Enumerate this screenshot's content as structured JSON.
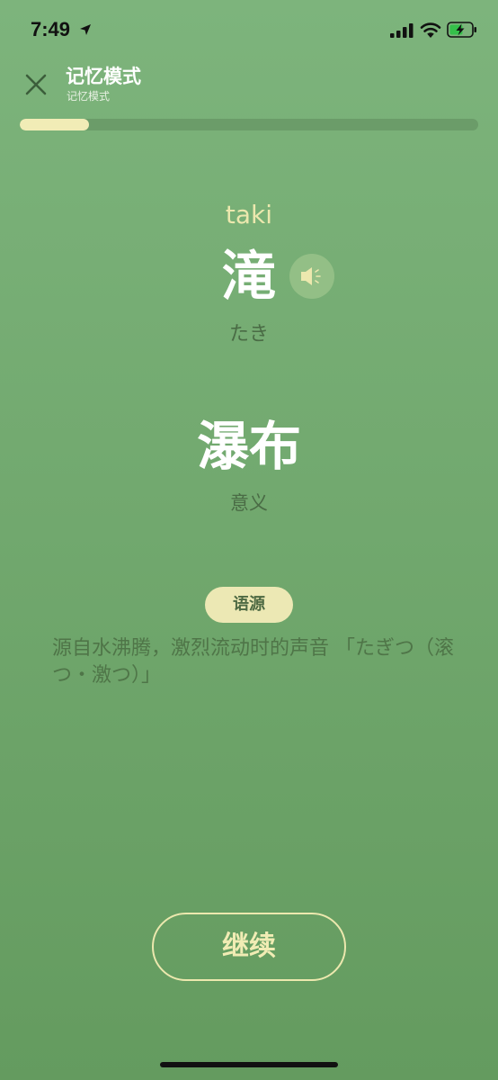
{
  "status_bar": {
    "time": "7:49",
    "icons": [
      "location-arrow-icon",
      "cellular-signal-icon",
      "wifi-icon",
      "battery-charging-icon"
    ]
  },
  "header": {
    "close_icon": "close-icon",
    "title": "记忆模式",
    "subtitle": "记忆模式"
  },
  "progress": {
    "fraction": 0.15,
    "fill_color": "#f1ecb6",
    "track_color": "#6b9c69"
  },
  "word": {
    "romaji": "taki",
    "kanji": "滝",
    "kana": "たき",
    "speaker_icon": "speaker-icon",
    "meaning": "瀑布",
    "meaning_label": "意义"
  },
  "etymology": {
    "badge_label": "语源",
    "text": "源自水沸腾，激烈流动时的声音 「たぎつ（滚つ・激つ）」"
  },
  "actions": {
    "continue_label": "继续"
  },
  "colors": {
    "background_top": "#7db47c",
    "background_bottom": "#649b5f",
    "accent": "#ece8ae",
    "muted_text": "#4a6b45"
  }
}
